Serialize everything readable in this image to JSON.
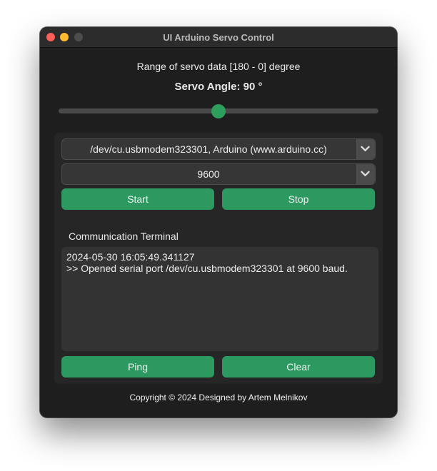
{
  "window": {
    "title": "UI Arduino Servo Control"
  },
  "servo": {
    "range_label": "Range of servo data [180 - 0] degree",
    "angle_label": "Servo Angle: 90 °",
    "slider_value": 90,
    "slider_min": 0,
    "slider_max": 180
  },
  "connection": {
    "port_selected": "/dev/cu.usbmodem323301, Arduino (www.arduino.cc)",
    "baud_selected": "9600",
    "start_label": "Start",
    "stop_label": "Stop"
  },
  "terminal": {
    "label": "Communication Terminal",
    "lines": [
      "2024-05-30 16:05:49.341127",
      ">> Opened serial port /dev/cu.usbmodem323301 at 9600 baud."
    ],
    "ping_label": "Ping",
    "clear_label": "Clear"
  },
  "footer": {
    "copyright": "Copyright © 2024 Designed by Artem Melnikov"
  },
  "colors": {
    "accent": "#2b9960",
    "window_bg": "#1e1e1e",
    "panel_bg": "#262626",
    "close": "#ff5f57",
    "minimize": "#febc2e",
    "maximize_disabled": "#4d4d4d"
  },
  "icons": {
    "combo_arrow": "chevron-down-icon"
  }
}
